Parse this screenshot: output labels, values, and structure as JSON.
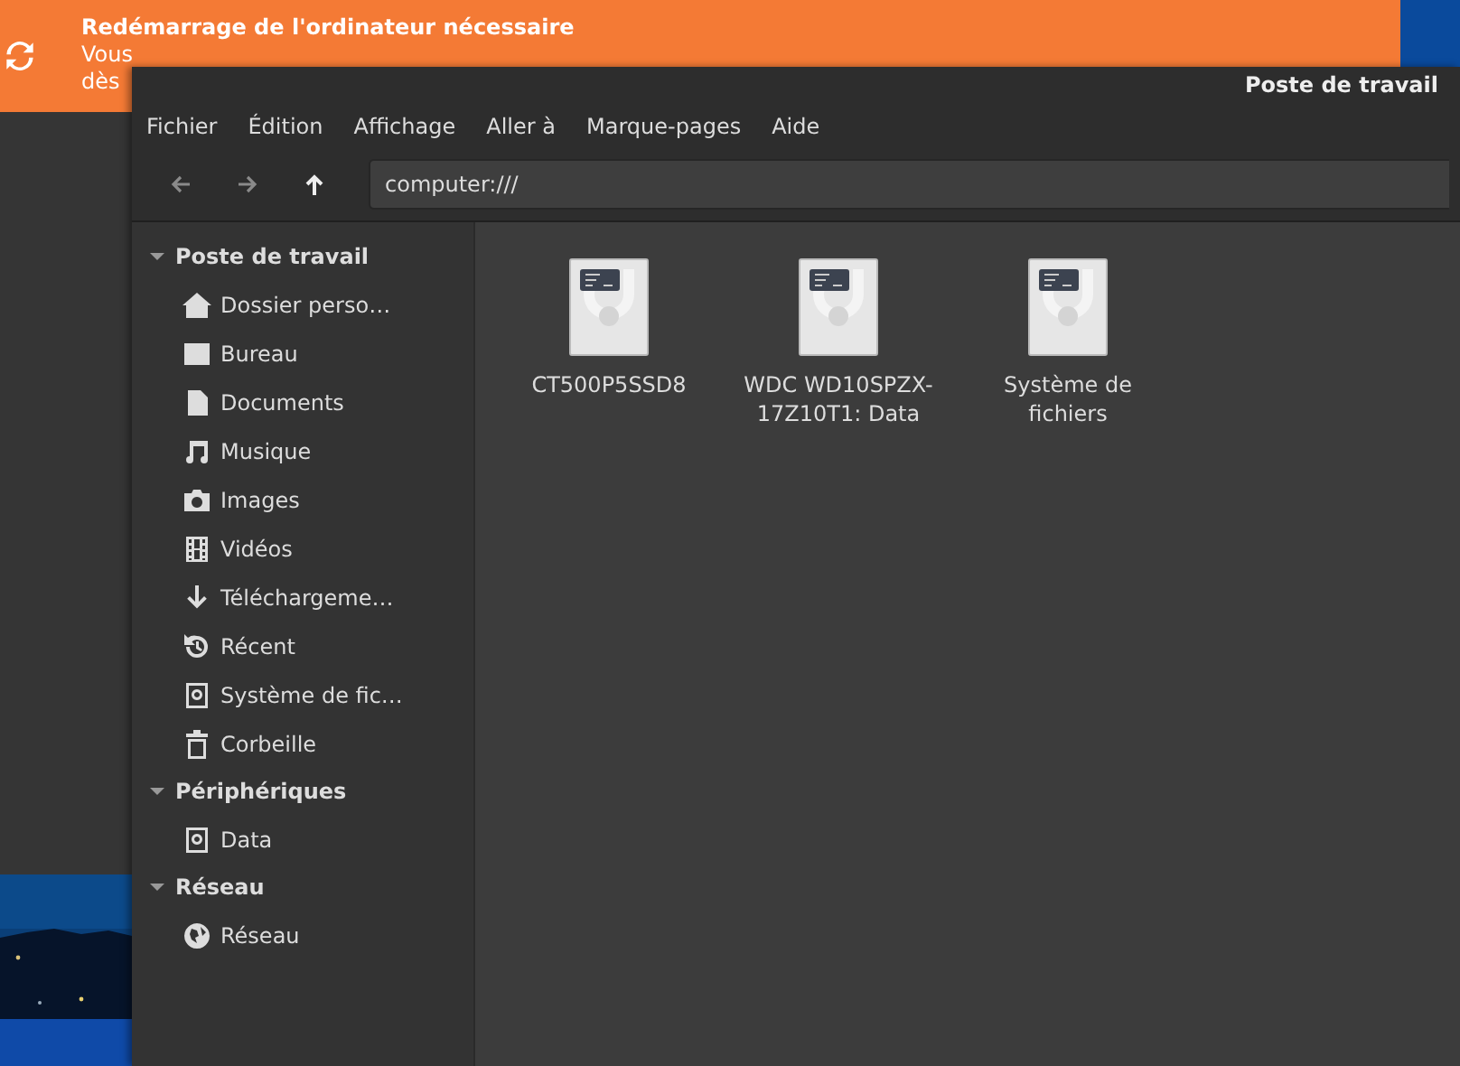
{
  "notification": {
    "title": "Redémarrage de l'ordinateur nécessaire",
    "lines": [
      "Vous",
      "dès"
    ]
  },
  "window": {
    "title": "Poste de travail"
  },
  "menu": [
    "Fichier",
    "Édition",
    "Affichage",
    "Aller à",
    "Marque-pages",
    "Aide"
  ],
  "toolbar": {
    "back_disabled": true,
    "forward_disabled": true,
    "location": "computer:///"
  },
  "sidebar": [
    {
      "title": "Poste de travail",
      "expanded": true,
      "items": [
        {
          "label": "Dossier perso…",
          "kind": "home"
        },
        {
          "label": "Bureau",
          "kind": "desktop"
        },
        {
          "label": "Documents",
          "kind": "document"
        },
        {
          "label": "Musique",
          "kind": "music"
        },
        {
          "label": "Images",
          "kind": "camera"
        },
        {
          "label": "Vidéos",
          "kind": "film"
        },
        {
          "label": "Téléchargeme…",
          "kind": "download"
        },
        {
          "label": "Récent",
          "kind": "history"
        },
        {
          "label": "Système de fic…",
          "kind": "drive"
        },
        {
          "label": "Corbeille",
          "kind": "trash"
        }
      ]
    },
    {
      "title": "Périphériques",
      "expanded": true,
      "items": [
        {
          "label": "Data",
          "kind": "drive"
        }
      ]
    },
    {
      "title": "Réseau",
      "expanded": true,
      "items": [
        {
          "label": "Réseau",
          "kind": "globe"
        }
      ]
    }
  ],
  "drives": [
    {
      "label": "CT500P5SSD8"
    },
    {
      "label": "WDC WD10SPZX-17Z10T1: Data"
    },
    {
      "label": "Système de fichiers"
    }
  ]
}
